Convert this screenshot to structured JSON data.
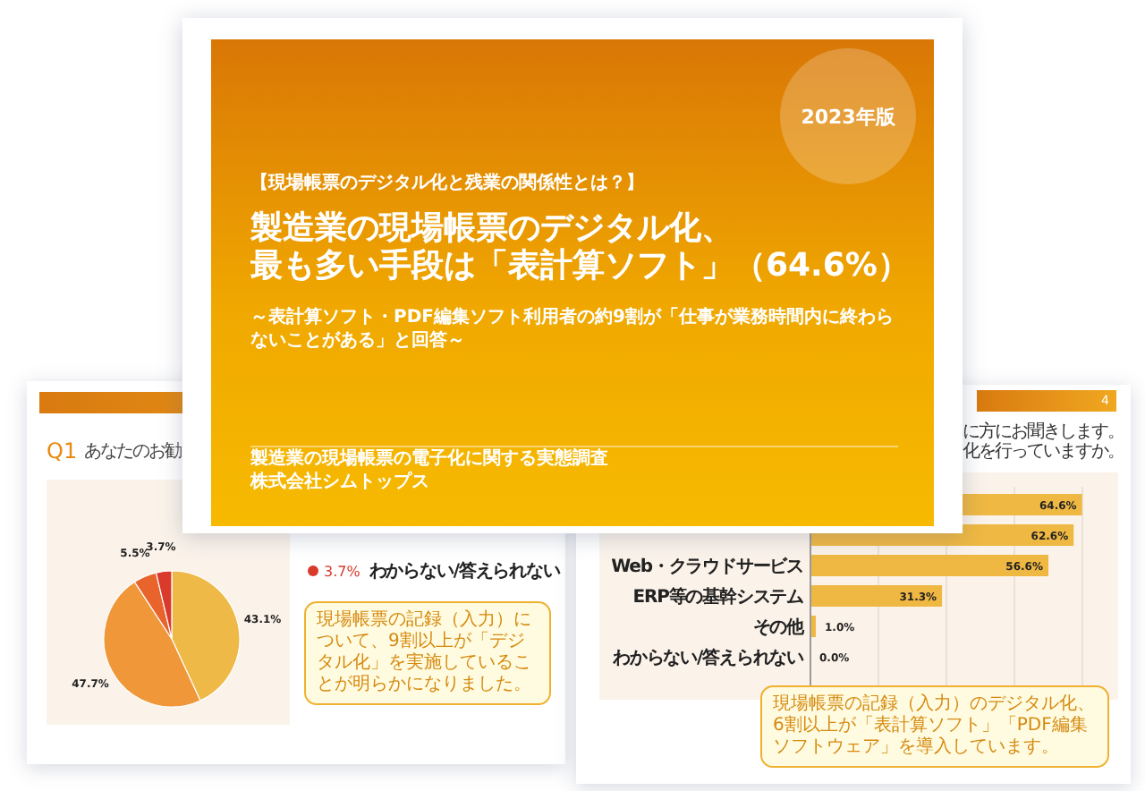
{
  "cover": {
    "badge": "2023年版",
    "kicker": "【現場帳票のデジタル化と残業の関係性とは？】",
    "title_lines": [
      "製造業の現場帳票のデジタル化、",
      "最も多い手段は「表計算ソフト」（64.6%）"
    ],
    "subtitle": "～表計算ソフト・PDF編集ソフト利用者の約9割が「仕事が業務時間内に終わらないことがある」と回答～",
    "footer_lines": [
      "製造業の現場帳票の電子化に関する実態調査",
      "株式会社シムトップス"
    ]
  },
  "left_page": {
    "question_number": "Q1",
    "question": "あなたのお勧",
    "chart_data": {
      "type": "pie",
      "values": [
        43.1,
        47.7,
        5.5,
        3.7
      ],
      "value_labels": [
        "43.1%",
        "47.7%",
        "5.5%",
        "3.7%"
      ],
      "colors": [
        "#eeb946",
        "#f0973a",
        "#e8642c",
        "#d93a2b"
      ]
    },
    "legend": [
      {
        "value": "3.7%",
        "label": "わからない/答えられない",
        "color": "#d93a2b"
      }
    ],
    "note": "現場帳票の記録（入力）について、9割以上が「デジタル化」を実施していることが明らかになりました。"
  },
  "right_page": {
    "page_number": "4",
    "question_lines": [
      "に方にお聞きします。",
      "化を行っていますか。"
    ],
    "chart_data": {
      "type": "bar",
      "orientation": "horizontal",
      "categories": [
        null,
        null,
        "Web・クラウドサービス",
        "ERP等の基幹システム",
        "その他",
        "わからない/答えられない"
      ],
      "values": [
        64.6,
        62.6,
        56.6,
        31.3,
        1.0,
        0.0
      ],
      "value_labels": [
        "64.6%",
        "62.6%",
        "56.6%",
        "31.3%",
        "1.0%",
        "0.0%"
      ]
    },
    "note": "現場帳票の記録（入力）のデジタル化、6割以上が「表計算ソフト」「PDF編集ソフトウェア」を導入しています。"
  }
}
